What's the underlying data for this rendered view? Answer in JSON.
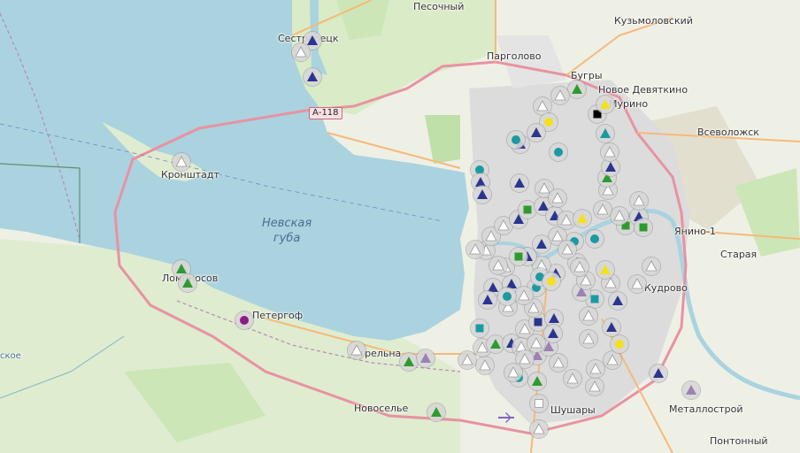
{
  "map": {
    "labels": {
      "pesochny": "Песочный",
      "kuzmolovsky": "Кузьмоловский",
      "sestroretsk": "Сестрорецк",
      "pargolovo": "Парголово",
      "bugry": "Бугры",
      "novoe_devyatkino": "Новое Девяткино",
      "murino": "Мурино",
      "vsevolozhsk": "Всеволожск",
      "kronshtadt": "Кронштадт",
      "nevskaya_guba": "Невская\nгуба",
      "yanino": "Янино-1",
      "staraya": "Старая",
      "lomonosov": "Ломоносов",
      "kudrovo": "Кудрово",
      "peterhof": "Петергоф",
      "strelna": "Стрельна",
      "novoselye": "Новоселье",
      "shushary": "Шушары",
      "metallostroy": "Металлострой",
      "pontonny": "Понтонный",
      "edge_left": "ское"
    },
    "road_shield": "А-118",
    "colors": {
      "water": "#aad3df",
      "land": "#eef0e6",
      "forest": "#cde6b7",
      "urban": "#dcdcdc",
      "ring_road": "#e892a2",
      "major_road": "#f6b979",
      "marker_bg": "#d6d6d6",
      "blue": "#2b3590",
      "green": "#2e9b2e",
      "yellow": "#f4e01f",
      "teal": "#1b9aa3",
      "purple": "#9b82b3",
      "white": "#ffffff",
      "magenta": "#8e1a84",
      "black": "#000000"
    }
  }
}
